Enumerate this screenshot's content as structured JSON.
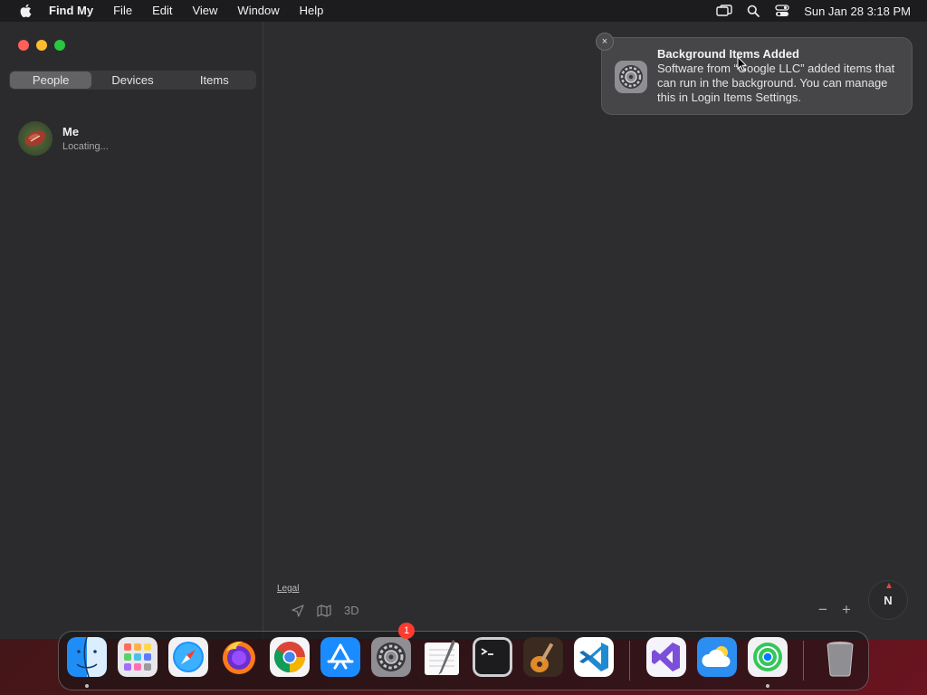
{
  "menubar": {
    "app_name": "Find My",
    "menus": [
      "File",
      "Edit",
      "View",
      "Window",
      "Help"
    ],
    "clock": "Sun Jan 28  3:18 PM"
  },
  "sidebar": {
    "tabs": [
      {
        "label": "People",
        "active": true
      },
      {
        "label": "Devices",
        "active": false
      },
      {
        "label": "Items",
        "active": false
      }
    ],
    "people": [
      {
        "name": "Me",
        "status": "Locating..."
      }
    ]
  },
  "map": {
    "legal": "Legal",
    "mode_3d": "3D",
    "compass": "N"
  },
  "notification": {
    "title": "Background Items Added",
    "body": "Software from “Google LLC” added items that can run in the background. You can manage this in Login Items Settings.",
    "close": "×"
  },
  "dock": {
    "settings_badge": "1",
    "apps": [
      "Finder",
      "Launchpad",
      "Safari",
      "Firefox",
      "Google Chrome",
      "App Store",
      "System Settings",
      "TextEdit",
      "Terminal",
      "GarageBand",
      "Visual Studio Code",
      "Visual Studio",
      "Weather",
      "Find My",
      "Trash"
    ]
  },
  "colors": {
    "accent_red": "#ff5f57",
    "accent_yellow": "#febc2e",
    "accent_green": "#28c840",
    "badge_red": "#ff3b30"
  }
}
